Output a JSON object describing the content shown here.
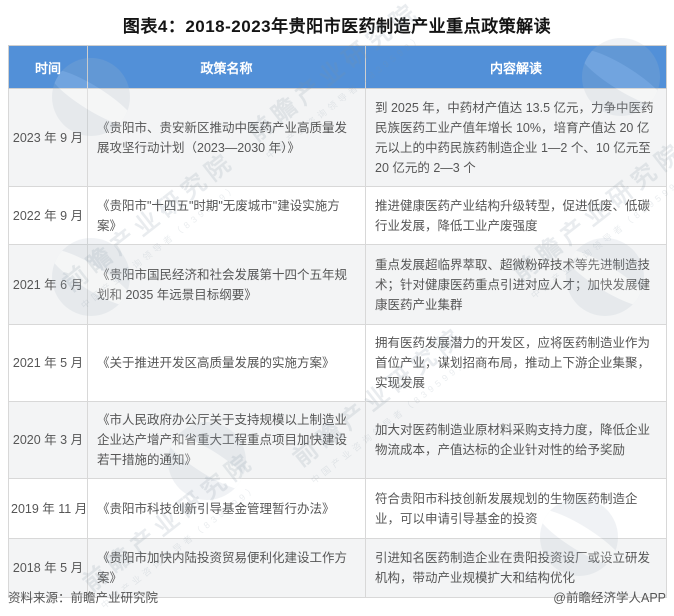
{
  "chart_data": {
    "type": "table",
    "title": "图表4：2018-2023年贵阳市医药制造产业重点政策解读",
    "columns": [
      "时间",
      "政策名称",
      "内容解读"
    ],
    "rows": [
      [
        "2023 年 9 月",
        "《贵阳市、贵安新区推动中医药产业高质量发展攻坚行动计划（2023—2030 年）》",
        "到 2025 年，中药材产值达 13.5 亿元，力争中医药民族医药工业产值年增长 10%，培育产值达 20 亿元以上的中药民族药制造企业 1—2 个、10 亿元至 20 亿元的 2—3 个"
      ],
      [
        "2022 年 9 月",
        "《贵阳市\"十四五\"时期\"无废城市\"建设实施方案》",
        "推进健康医药产业结构升级转型，促进低废、低碳行业发展，降低工业产废强度"
      ],
      [
        "2021 年 6 月",
        "《贵阳市国民经济和社会发展第十四个五年规划和 2035 年远景目标纲要》",
        "重点发展超临界萃取、超微粉碎技术等先进制造技术；针对健康医药重点引进对应人才；加快发展健康医药产业集群"
      ],
      [
        "2021 年 5 月",
        "《关于推进开发区高质量发展的实施方案》",
        "拥有医药发展潜力的开发区，应将医药制造业作为首位产业，谋划招商布局，推动上下游企业集聚，实现发展"
      ],
      [
        "2020 年 3 月",
        "《市人民政府办公厅关于支持规模以上制造业企业达产增产和省重大工程重点项目加快建设若干措施的通知》",
        "加大对医药制造业原材料采购支持力度，降低企业物流成本，产值达标的企业针对性的给予奖励"
      ],
      [
        "2019 年 11 月",
        "《贵阳市科技创新引导基金管理暂行办法》",
        "符合贵阳市科技创新发展规划的生物医药制造企业，可以申请引导基金的投资"
      ],
      [
        "2018 年 5 月",
        "《贵阳市加快内陆投资贸易便利化建设工作方案》",
        "引进知名医药制造企业在贵阳投资设厂或设立研发机构，带动产业规模扩大和结构优化"
      ]
    ],
    "layout": {
      "header_position": "top",
      "alternating_rows": true
    }
  },
  "footer": {
    "source": "资料来源：前瞻产业研究院",
    "credit": "@前瞻经济学人APP"
  },
  "watermark": {
    "text": "前瞻产业研究院",
    "subtext": "中国产业咨询领导者（839599）"
  },
  "colors": {
    "header_bg": "#5290D8",
    "header_text": "#FFFFFF",
    "alt_row_bg": "#F3F4F5",
    "row_bg": "#FFFFFF",
    "border": "#D8D8D8",
    "body_text": "#565656",
    "title_text": "#141414"
  }
}
